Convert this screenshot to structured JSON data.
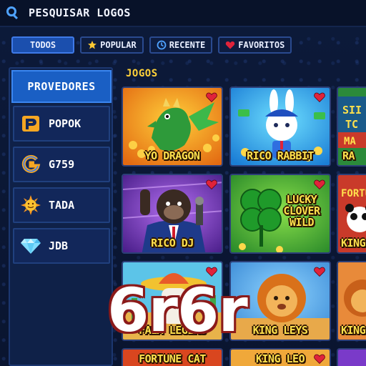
{
  "search": {
    "label": "PESQUISAR LOGOS",
    "icon": "search-icon"
  },
  "tabs": [
    {
      "label": "TODOS",
      "active": true,
      "icon": ""
    },
    {
      "label": "POPULAR",
      "active": false,
      "icon": "star-icon"
    },
    {
      "label": "RECENTE",
      "active": false,
      "icon": "clock-icon"
    },
    {
      "label": "FAVORITOS",
      "active": false,
      "icon": "heart-icon"
    }
  ],
  "sidebar": {
    "title": "PROVEDORES",
    "providers": [
      {
        "label": "POPOK",
        "icon": "popok-logo-icon"
      },
      {
        "label": "G759",
        "icon": "g759-logo-icon"
      },
      {
        "label": "TADA",
        "icon": "sun-icon"
      },
      {
        "label": "JDB",
        "icon": "diamond-icon"
      }
    ]
  },
  "games": {
    "label": "JOGOS",
    "cards": [
      {
        "title": "YO DRAGON"
      },
      {
        "title": "RICO RABBIT"
      },
      {
        "title": "RA"
      },
      {
        "title": "RICO DJ"
      },
      {
        "title": "LUCKY\nCLOVER\nWILD"
      },
      {
        "title": "KING"
      },
      {
        "title": "FALA LEGIRS"
      },
      {
        "title": "KING LEYS"
      },
      {
        "title": "KING"
      },
      {
        "title": "FORTUNE CAT"
      },
      {
        "title": "KING LEO"
      }
    ]
  },
  "watermark": {
    "text": "6r6r"
  },
  "colors": {
    "background": "#0b1733",
    "accent": "#1a5fc4",
    "title_yellow": "#ffe14d",
    "heart_red": "#e0233a"
  }
}
